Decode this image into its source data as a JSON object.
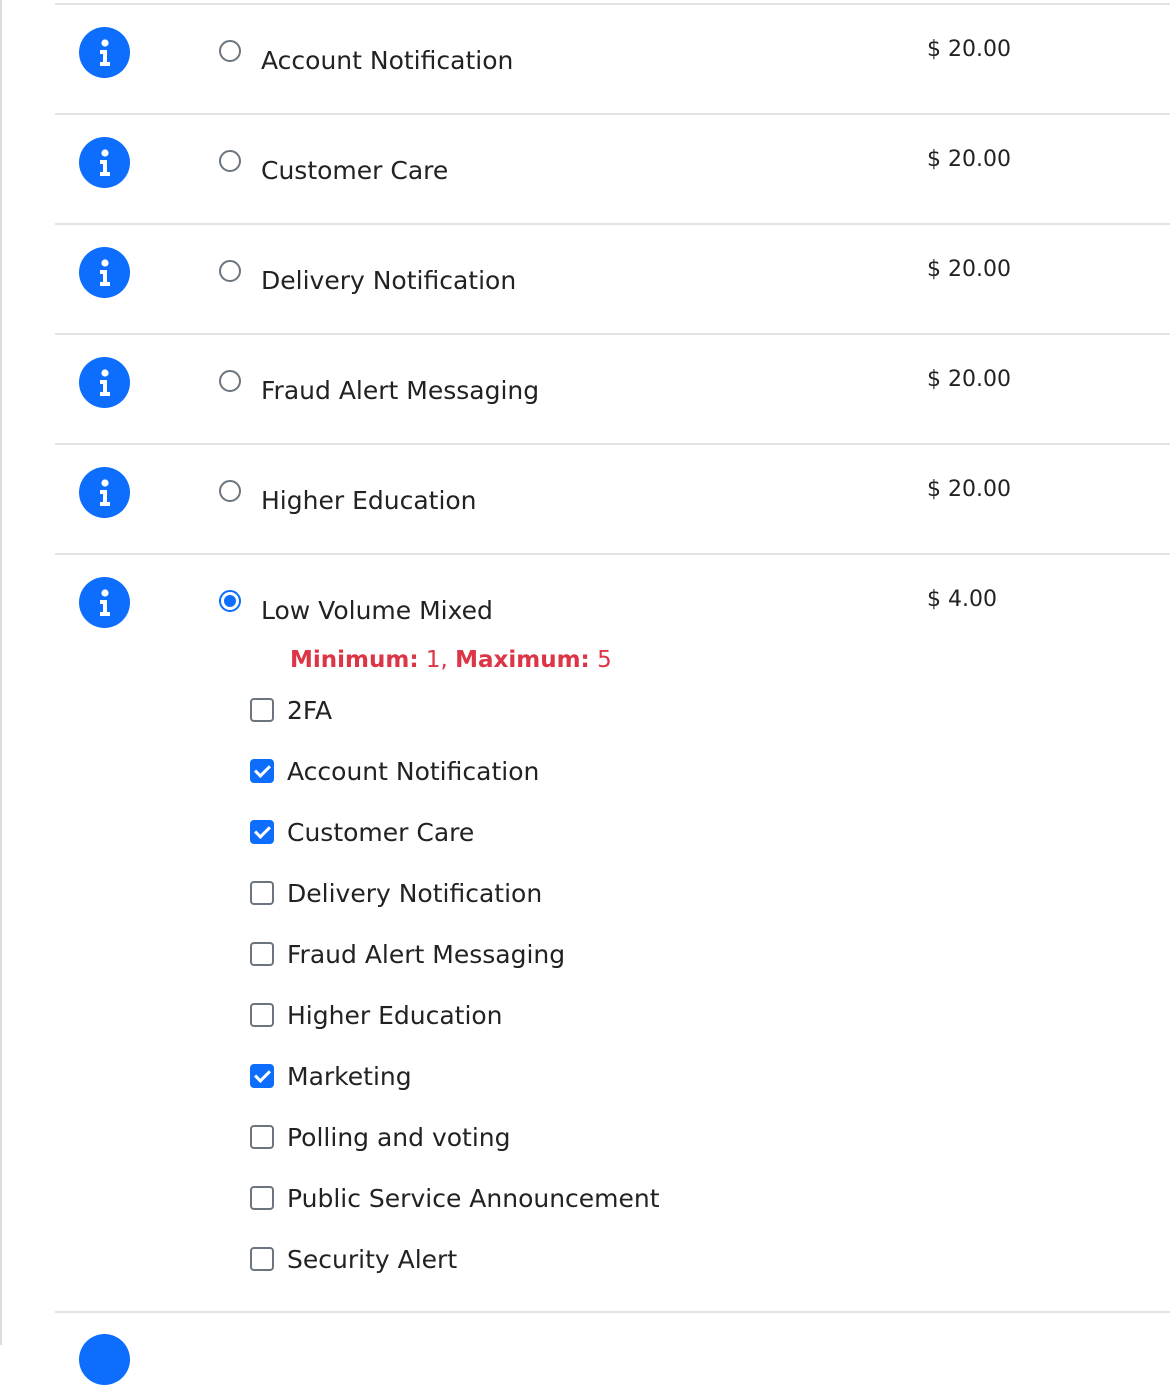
{
  "options": [
    {
      "label": "Account Notification",
      "price": "$ 20.00",
      "selected": false
    },
    {
      "label": "Customer Care",
      "price": "$ 20.00",
      "selected": false
    },
    {
      "label": "Delivery Notification",
      "price": "$ 20.00",
      "selected": false
    },
    {
      "label": "Fraud Alert Messaging",
      "price": "$ 20.00",
      "selected": false
    },
    {
      "label": "Higher Education",
      "price": "$ 20.00",
      "selected": false
    },
    {
      "label": "Low Volume Mixed",
      "price": "$ 4.00",
      "selected": true
    }
  ],
  "mixed": {
    "minimum_label": "Minimum:",
    "minimum_value": "1,",
    "maximum_label": "Maximum:",
    "maximum_value": "5",
    "items": [
      {
        "label": "2FA",
        "checked": false
      },
      {
        "label": "Account Notification",
        "checked": true
      },
      {
        "label": "Customer Care",
        "checked": true
      },
      {
        "label": "Delivery Notification",
        "checked": false
      },
      {
        "label": "Fraud Alert Messaging",
        "checked": false
      },
      {
        "label": "Higher Education",
        "checked": false
      },
      {
        "label": "Marketing",
        "checked": true
      },
      {
        "label": "Polling and voting",
        "checked": false
      },
      {
        "label": "Public Service Announcement",
        "checked": false
      },
      {
        "label": "Security Alert",
        "checked": false
      }
    ]
  },
  "colors": {
    "accent": "#0d6efd",
    "error": "#dc3545"
  },
  "icons": {
    "info": "info-circle-icon"
  }
}
